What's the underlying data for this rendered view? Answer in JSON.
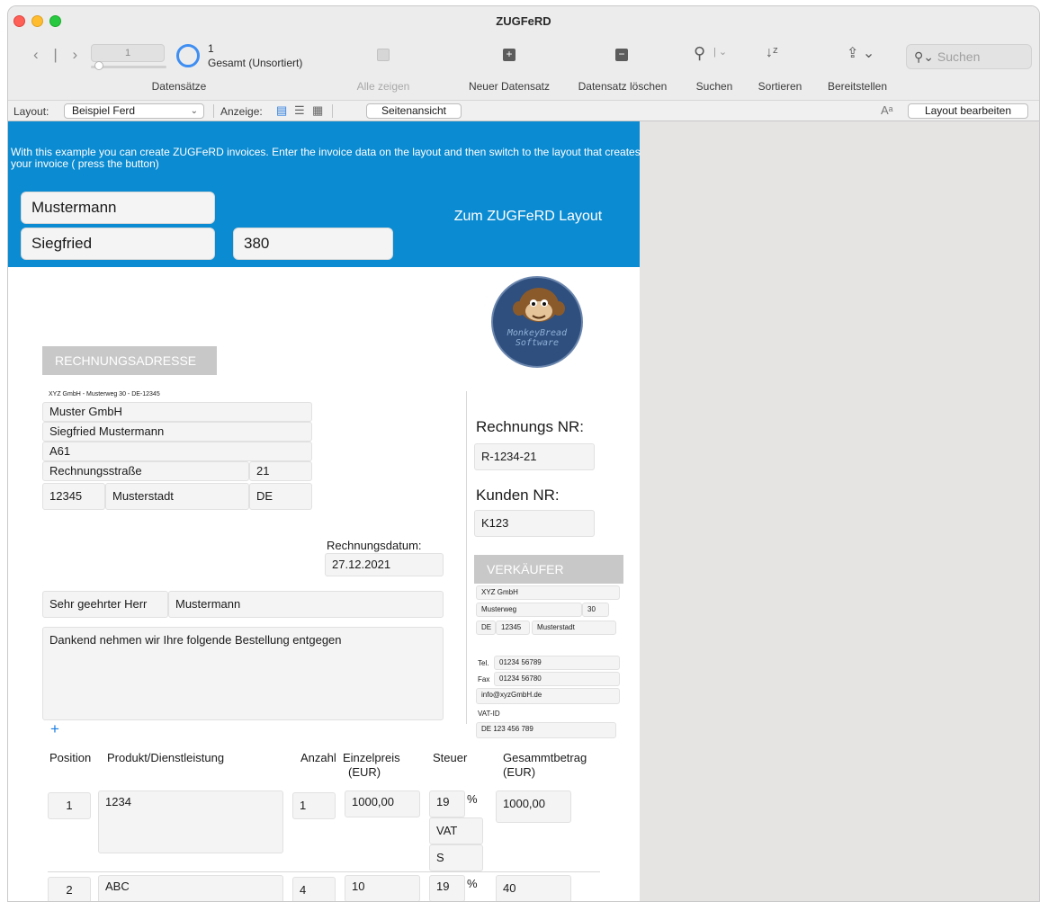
{
  "window": {
    "title": "ZUGFeRD"
  },
  "toolbar": {
    "record_current": "1",
    "record_count": "1",
    "record_total": "Gesamt (Unsortiert)",
    "records_label": "Datensätze",
    "show_all_label": "Alle zeigen",
    "new_record_label": "Neuer Datensatz",
    "delete_record_label": "Datensatz löschen",
    "search_label": "Suchen",
    "sort_label": "Sortieren",
    "share_label": "Bereitstellen",
    "search_placeholder": "Suchen"
  },
  "layoutbar": {
    "layout_label": "Layout:",
    "layout_value": "Beispiel Ferd",
    "view_label": "Anzeige:",
    "preview_button": "Seitenansicht",
    "edit_layout_button": "Layout bearbeiten"
  },
  "header": {
    "intro_text": "With this example you can create ZUGFeRD invoices. Enter the invoice data on the layout and then switch to the layout that creates your invoice ( press the button)",
    "last_name": "Mustermann",
    "first_name": "Siegfried",
    "number": "380",
    "switch_button": "Zum ZUGFeRD Layout"
  },
  "invoice": {
    "billing_band": "RECHNUNGSADRESSE",
    "sender_line": "XYZ GmbH - Musterweg 30 - DE-12345",
    "address": {
      "company": "Muster GmbH",
      "contact": "Siegfried Mustermann",
      "line3": "A61",
      "street": "Rechnungsstraße",
      "house_no": "21",
      "zip": "12345",
      "city": "Musterstadt",
      "country": "DE"
    },
    "invoice_no_label": "Rechnungs NR:",
    "invoice_no": "R-1234-21",
    "customer_no_label": "Kunden NR:",
    "customer_no": "K123",
    "date_label": "Rechnungsdatum:",
    "date": "27.12.2021",
    "salutation": "Sehr geehrter Herr",
    "salutation_name": "Mustermann",
    "message": "Dankend nehmen wir Ihre folgende Bestellung entgegen",
    "seller": {
      "band": "VERKÄUFER",
      "name": "XYZ GmbH",
      "street": "Musterweg",
      "house_no": "30",
      "country": "DE",
      "zip": "12345",
      "city": "Musterstadt",
      "tel_label": "Tel.",
      "tel": "01234 56789",
      "fax_label": "Fax",
      "fax": "01234 56780",
      "email": "info@xyzGmbH.de",
      "vat_label": "VAT-ID",
      "vat_id": "DE 123 456 789"
    },
    "logo": {
      "line1": "MonkeyBread",
      "line2": "Software"
    },
    "add_symbol": "+",
    "columns": {
      "position": "Position",
      "product": "Produkt/Dienstleistung",
      "qty": "Anzahl",
      "unit_price": "Einzelpreis",
      "unit_price_unit": "(EUR)",
      "tax": "Steuer",
      "total": "Gesammtbetrag",
      "total_unit": "(EUR)"
    },
    "items": [
      {
        "pos": "1",
        "product": "1234",
        "qty": "1",
        "price": "1000,00",
        "tax": "19",
        "tax_unit": "%",
        "tax_type": "VAT",
        "tax_cat": "S",
        "total": "1000,00"
      },
      {
        "pos": "2",
        "product": "ABC",
        "qty": "4",
        "price": "10",
        "tax": "19",
        "tax_unit": "%",
        "total": "40"
      }
    ]
  },
  "colors": {
    "header_blue": "#0b8bd1",
    "band_grey": "#c8c8c8",
    "accent_blue": "#3f8ef2"
  }
}
